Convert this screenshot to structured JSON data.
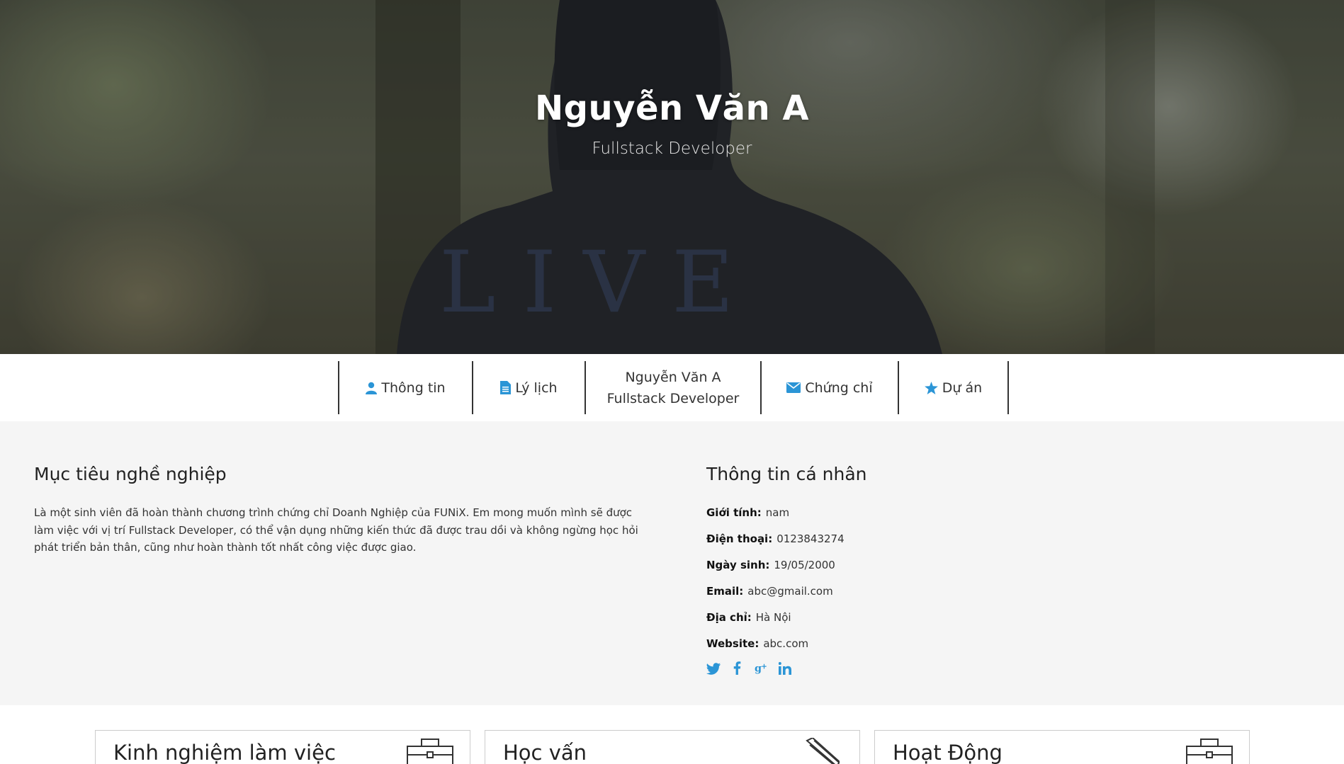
{
  "hero": {
    "name": "Nguyễn Văn A",
    "role": "Fullstack Developer"
  },
  "nav": {
    "items": [
      {
        "label": "Thông tin",
        "icon": "user-icon"
      },
      {
        "label": "Lý lịch",
        "icon": "file-icon"
      },
      {
        "label": "Chứng chỉ",
        "icon": "envelope-icon"
      },
      {
        "label": "Dự án",
        "icon": "star-icon"
      }
    ],
    "center_name": "Nguyễn Văn A",
    "center_role": "Fullstack Developer"
  },
  "career": {
    "heading": "Mục tiêu nghề nghiệp",
    "text": "Là một sinh viên đã hoàn thành chương trình chứng chỉ Doanh Nghiệp của FUNiX. Em mong muốn mình sẽ được làm việc với vị trí Fullstack Developer, có thể vận dụng những kiến thức đã được trau dồi và không ngừng học hỏi phát triển bản thân, cũng như hoàn thành tốt nhất công việc được giao."
  },
  "personal": {
    "heading": "Thông tin cá nhân",
    "fields": [
      {
        "label": "Giới tính:",
        "value": "nam"
      },
      {
        "label": "Điện thoại:",
        "value": "0123843274"
      },
      {
        "label": "Ngày sinh:",
        "value": "19/05/2000"
      },
      {
        "label": "Email:",
        "value": "abc@gmail.com"
      },
      {
        "label": "Địa chỉ:",
        "value": "Hà Nội"
      },
      {
        "label": "Website:",
        "value": "abc.com"
      }
    ],
    "social": [
      "twitter-icon",
      "facebook-icon",
      "google-plus-icon",
      "linkedin-icon"
    ]
  },
  "cards": [
    {
      "title": "Kinh nghiệm làm việc",
      "icon": "briefcase-icon"
    },
    {
      "title": "Học vấn",
      "icon": "pencil-icon"
    },
    {
      "title": "Hoạt Động",
      "icon": "briefcase-icon"
    }
  ],
  "colors": {
    "accent": "#2b95d6",
    "section_bg": "#f5f5f5"
  }
}
